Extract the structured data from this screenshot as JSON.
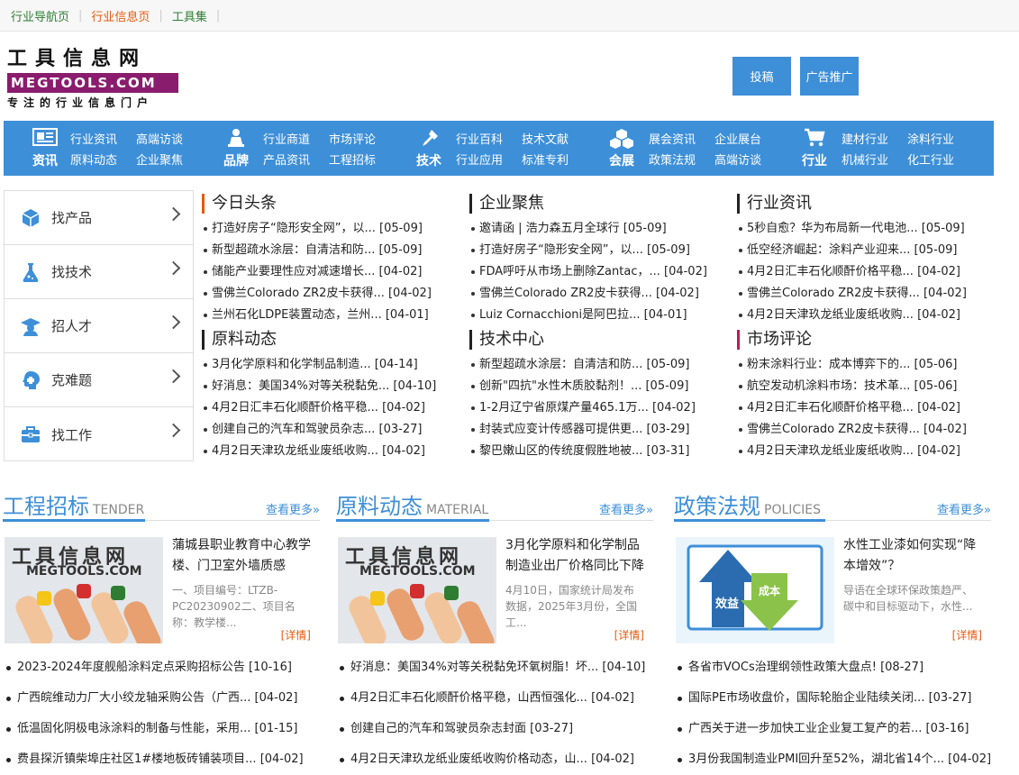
{
  "topbar": {
    "links": [
      "行业导航页",
      "行业信息页",
      "工具集"
    ]
  },
  "logo": {
    "cn": "工具信息网",
    "en": "MEGTOOLS.COM",
    "slogan": "专注的行业信息门户"
  },
  "header_buttons": [
    "投稿",
    "广告推广"
  ],
  "nav": [
    {
      "cat": "资讯",
      "icon": "news-icon",
      "links": [
        "行业资讯",
        "高端访谈",
        "原料动态",
        "企业聚焦"
      ]
    },
    {
      "cat": "品牌",
      "icon": "brand-icon",
      "links": [
        "行业商道",
        "市场评论",
        "产品资讯",
        "工程招标"
      ]
    },
    {
      "cat": "技术",
      "icon": "tech-icon",
      "links": [
        "行业百科",
        "技术文献",
        "行业应用",
        "标准专利"
      ]
    },
    {
      "cat": "会展",
      "icon": "expo-icon",
      "links": [
        "展会资讯",
        "企业展台",
        "政策法规",
        "高端访谈"
      ]
    },
    {
      "cat": "行业",
      "icon": "cart-icon",
      "links": [
        "建材行业",
        "涂料行业",
        "机械行业",
        "化工行业"
      ]
    }
  ],
  "sidebar": [
    {
      "label": "找产品",
      "icon": "cube-icon"
    },
    {
      "label": "找技术",
      "icon": "flask-icon"
    },
    {
      "label": "招人才",
      "icon": "graduate-icon"
    },
    {
      "label": "克难题",
      "icon": "brain-icon"
    },
    {
      "label": "找工作",
      "icon": "briefcase-icon"
    }
  ],
  "news_blocks": [
    {
      "title": "今日头条",
      "accent": "#e8590c",
      "items": [
        "打造好房子“隐形安全网”，以... [05-09]",
        "新型超疏水涂层：自清洁和防... [05-09]",
        "储能产业要理性应对减速增长... [04-02]",
        "雪佛兰Colorado ZR2皮卡获得... [04-02]",
        "兰州石化LDPE装置动态，兰州... [04-01]"
      ]
    },
    {
      "title": "企业聚焦",
      "accent": "#222222",
      "items": [
        "邀请函 | 浩力森五月全球行 [05-09]",
        "打造好房子“隐形安全网”，以... [05-09]",
        "FDA呼吁从市场上删除Zantac，... [04-02]",
        "雪佛兰Colorado ZR2皮卡获得... [04-02]",
        "Luiz Cornacchioni是阿巴拉... [04-01]"
      ]
    },
    {
      "title": "行业资讯",
      "accent": "#222222",
      "items": [
        "5秒自愈？华为布局新一代电池... [05-09]",
        "低空经济崛起：涂料产业迎来... [05-09]",
        "4月2日汇丰石化顺酐价格平稳... [04-02]",
        "雪佛兰Colorado ZR2皮卡获得... [04-02]",
        "4月2日天津玖龙纸业废纸收购... [04-02]"
      ]
    },
    {
      "title": "原料动态",
      "accent": "#222222",
      "items": [
        "3月化学原料和化学制品制造... [04-14]",
        "好消息：美国34%对等关税黏免... [04-10]",
        "4月2日汇丰石化顺酐价格平稳... [04-02]",
        "创建自己的汽车和驾驶员杂志... [03-27]",
        "4月2日天津玖龙纸业废纸收购... [04-02]"
      ]
    },
    {
      "title": "技术中心",
      "accent": "#222222",
      "items": [
        "新型超疏水涂层：自清洁和防... [05-09]",
        "创新\"四抗\"水性木质胶黏剂！... [05-09]",
        "1-2月辽宁省原煤产量465.1万... [04-02]",
        "封装式应变计传感器可提供更... [03-29]",
        "黎巴嫩山区的传统度假胜地被... [03-31]"
      ]
    },
    {
      "title": "市场评论",
      "accent": "#c2185b",
      "items": [
        "粉末涂料行业：成本博弈下的... [05-06]",
        "航空发动机涂料市场：技术革... [05-06]",
        "4月2日汇丰石化顺酐价格平稳... [04-02]",
        "雪佛兰Colorado ZR2皮卡获得... [04-02]",
        "4月2日天津玖龙纸业废纸收购... [04-02]"
      ]
    }
  ],
  "sections": [
    {
      "title": "工程招标",
      "en": "TENDER",
      "more": "查看更多»",
      "feat_title": "蒲城县职业教育中心教学楼、门卫室外墙质感",
      "feat_desc": "一、项目编号：LTZB-PC20230902二、项目名称：教学楼...",
      "detail": "[详情]",
      "thumb_cn": "工具信息网",
      "thumb_en": "MEGTOOLS.COM",
      "items": [
        "2023-2024年度舰船涂料定点采购招标公告 [10-16]",
        "广西皖维动力厂大小绞龙轴采购公告（广西... [04-02]",
        "低温固化阴极电泳涂料的制备与性能，采用... [01-15]",
        "费县探沂镇柴埠庄社区1#楼地板砖铺装项目... [04-02]"
      ]
    },
    {
      "title": "原料动态",
      "en": "MATERIAL",
      "more": "查看更多»",
      "feat_title": "3月化学原料和化学制品制造业出厂价格同比下降",
      "feat_desc": "4月10日，国家统计局发布数据，2025年3月份，全国工...",
      "detail": "[详情]",
      "thumb_cn": "工具信息网",
      "thumb_en": "MEGTOOLS.COM",
      "items": [
        "好消息：美国34%对等关税黏免环氧树脂！坏... [04-10]",
        "4月2日汇丰石化顺酐价格平稳，山西恒强化... [04-02]",
        "创建自己的汽车和驾驶员杂志封面 [03-27]",
        "4月2日天津玖龙纸业废纸收购价格动态，山... [04-02]"
      ]
    },
    {
      "title": "政策法规",
      "en": "POLICIES",
      "more": "查看更多»",
      "feat_title": "水性工业漆如何实现“降本增效”？",
      "feat_desc": "导语在全球环保政策趋严、碳中和目标驱动下，水性...",
      "detail": "[详情]",
      "thumb_up": "效益",
      "thumb_down": "成本",
      "items": [
        "各省市VOCs治理纲领性政策大盘点! [08-27]",
        "国际PE市场收盘价，国际轮胎企业陆续关闭... [03-27]",
        "广西关于进一步加快工业企业复工复产的若... [03-16]",
        "3月份我国制造业PMI回升至52%，湖北省14个... [04-02]"
      ]
    }
  ]
}
